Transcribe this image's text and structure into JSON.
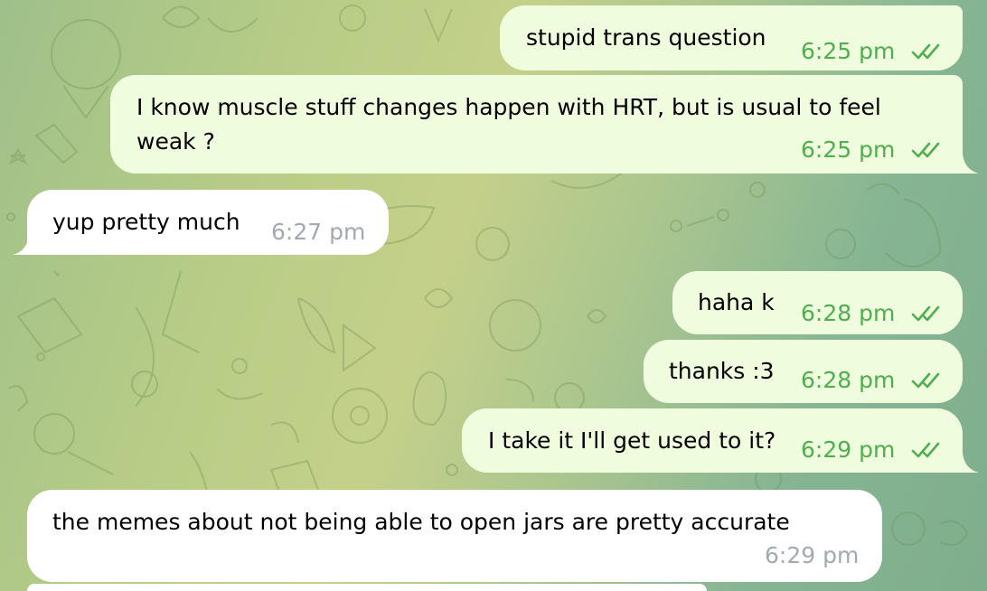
{
  "messages": [
    {
      "text": "stupid trans question",
      "time": "6:25 pm",
      "direction": "out",
      "status": "read"
    },
    {
      "text": "I know muscle stuff changes happen with HRT, but is usual to feel",
      "text2": "weak ?",
      "time": "6:25 pm",
      "direction": "out",
      "status": "read"
    },
    {
      "text": "yup pretty much",
      "time": "6:27 pm",
      "direction": "in"
    },
    {
      "text": "haha k",
      "time": "6:28 pm",
      "direction": "out",
      "status": "read"
    },
    {
      "text": "thanks :3",
      "time": "6:28 pm",
      "direction": "out",
      "status": "read"
    },
    {
      "text": "I take it I'll get used to it?",
      "time": "6:29 pm",
      "direction": "out",
      "status": "read"
    },
    {
      "text": "the memes about not being able to open jars are pretty accurate",
      "time": "6:29 pm",
      "direction": "in"
    }
  ],
  "colors": {
    "outgoing_bubble": "#effdde",
    "incoming_bubble": "#ffffff",
    "outgoing_meta": "#4fae4e",
    "incoming_meta": "#a1aab3"
  },
  "icons": {
    "read_receipt": "double-check-icon"
  }
}
